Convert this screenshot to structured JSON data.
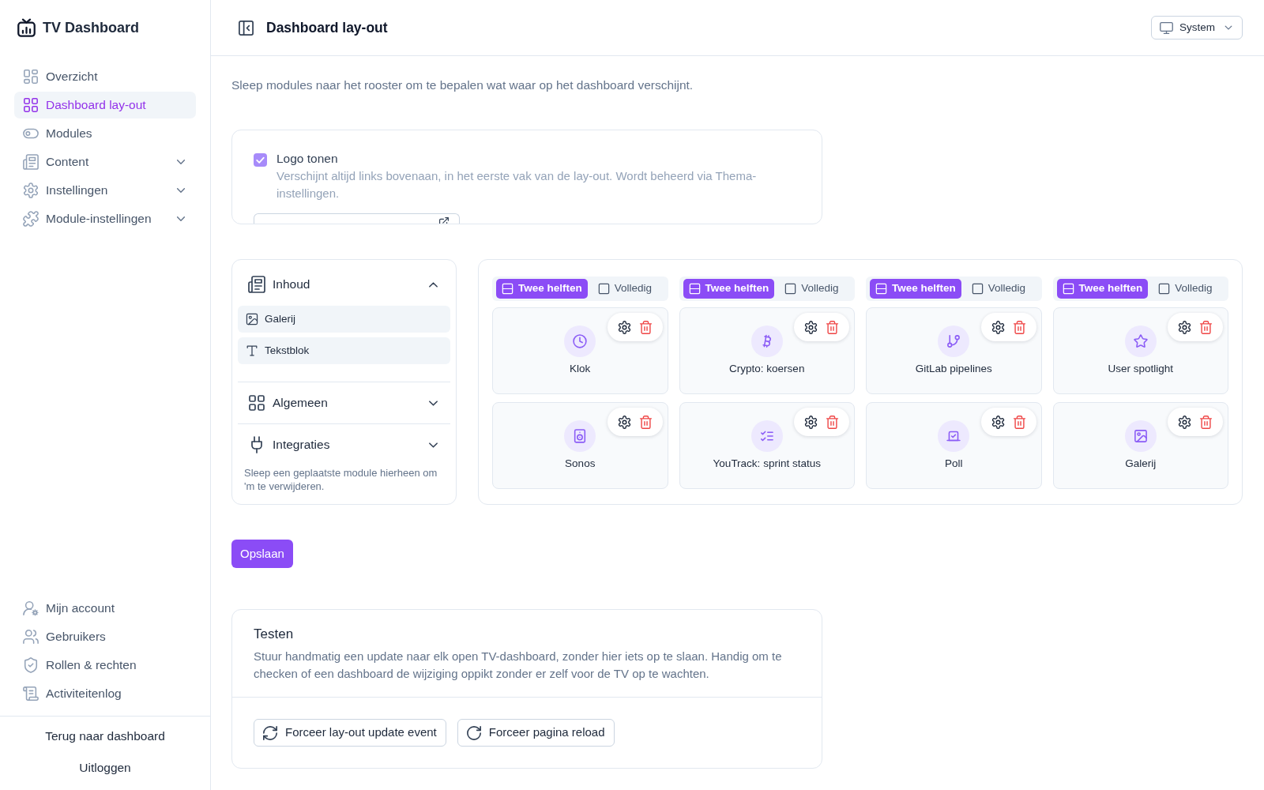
{
  "sidebar": {
    "brand": "TV Dashboard",
    "items": [
      {
        "label": "Overzicht",
        "selected": false
      },
      {
        "label": "Dashboard lay-out",
        "selected": true
      },
      {
        "label": "Modules",
        "selected": false
      },
      {
        "label": "Content",
        "selected": false,
        "expanded": false
      },
      {
        "label": "Instellingen",
        "selected": false,
        "expanded": false
      },
      {
        "label": "Module-instellingen",
        "selected": false,
        "expanded": false
      }
    ],
    "account_items": [
      {
        "label": "Mijn account",
        "selected": false
      },
      {
        "label": "Gebruikers",
        "selected": false
      },
      {
        "label": "Rollen & rechten",
        "selected": false
      },
      {
        "label": "Activiteitenlog",
        "selected": false
      }
    ],
    "footer_links": [
      "Terug naar dashboard",
      "Uitloggen"
    ]
  },
  "header": {
    "title": "Dashboard lay-out",
    "theme_select": {
      "value": "System"
    }
  },
  "intro": "Sleep modules naar het rooster om te bepalen wat waar op het dashboard verschijnt.",
  "logo_card": {
    "checkbox": {
      "label": "Logo tonen",
      "checked": true
    },
    "description": "Verschijnt altijd links bovenaan, in het eerste vak van de lay-out. Wordt beheerd via Thema-instellingen."
  },
  "palette": {
    "groups": [
      {
        "title": "Inhoud",
        "expanded": true,
        "items": [
          "Galerij",
          "Tekstblok"
        ]
      },
      {
        "title": "Algemeen",
        "expanded": false
      },
      {
        "title": "Integraties",
        "expanded": false
      }
    ],
    "hint": "Sleep een geplaatste module hierheen om 'm te verwijderen."
  },
  "grid": {
    "columns": [
      {
        "width_options": [
          {
            "label": "Twee helften",
            "selected": true
          },
          {
            "label": "Volledig",
            "selected": false
          }
        ],
        "modules": [
          "Klok",
          "Sonos"
        ]
      },
      {
        "width_options": [
          {
            "label": "Twee helften",
            "selected": true
          },
          {
            "label": "Volledig",
            "selected": false
          }
        ],
        "modules": [
          "Crypto: koersen",
          "YouTrack: sprint status"
        ]
      },
      {
        "width_options": [
          {
            "label": "Twee helften",
            "selected": true
          },
          {
            "label": "Volledig",
            "selected": false
          }
        ],
        "modules": [
          "GitLab pipelines",
          "Poll"
        ]
      },
      {
        "width_options": [
          {
            "label": "Twee helften",
            "selected": true
          },
          {
            "label": "Volledig",
            "selected": false
          }
        ],
        "modules": [
          "User spotlight",
          "Galerij"
        ]
      }
    ]
  },
  "save_button": "Opslaan",
  "test_card": {
    "title": "Testen",
    "description": "Stuur handmatig een update naar elk open TV-dashboard, zonder hier iets op te slaan. Handig om te checken of een dashboard de wijziging oppikt zonder er zelf voor de TV op te wachten.",
    "buttons": [
      "Forceer lay-out update event",
      "Forceer pagina reload"
    ]
  }
}
